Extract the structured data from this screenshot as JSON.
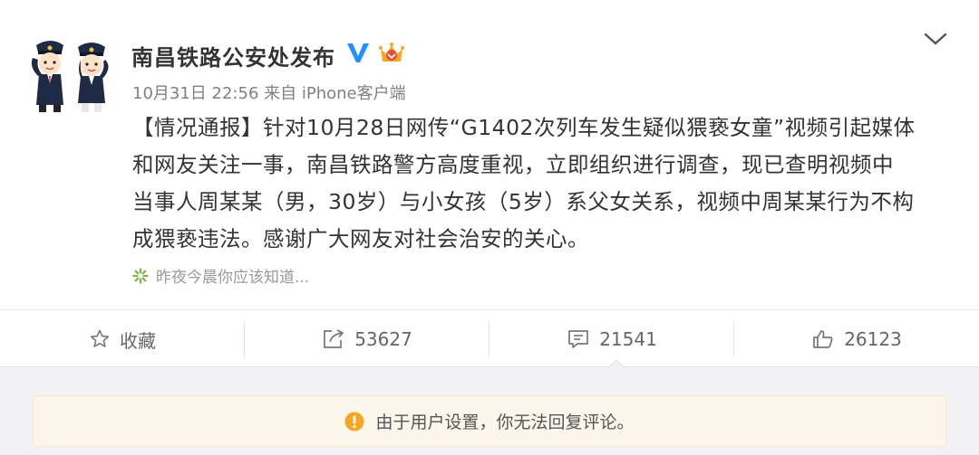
{
  "post": {
    "username": "南昌铁路公安处发布",
    "verified_badge": "V",
    "timestamp": "10月31日 22:56",
    "source_prefix": "来自",
    "client": "iPhone客户端",
    "content_lines": [
      "【情况通报】针对10月28日网传“G1402次列车发生疑似猥亵女童”视频引起媒体",
      "和网友关注一事，南昌铁路警方高度重视，立即组织进行调查，现已查明视频中",
      "当事人周某某（男，30岁）与小女孩（5岁）系父女关系，视频中周某某行为不构",
      "成猥亵违法。感谢广大网友对社会治安的关心。"
    ],
    "origin": "昨夜今晨你应该知道..."
  },
  "actions": {
    "favorite_label": "收藏",
    "repost_count": "53627",
    "comment_count": "21541",
    "like_count": "26123"
  },
  "notice": {
    "text": "由于用户设置，你无法回复评论。"
  },
  "colors": {
    "verified_blue": "#1e90ff",
    "warning_orange": "#f5a623",
    "spark_green": "#7ab648",
    "notice_bg": "#fdf6ec"
  },
  "icons": [
    "police-avatar",
    "verified-icon",
    "vip-crown-icon",
    "chevron-down-icon",
    "spark-icon",
    "star-icon",
    "repost-icon",
    "comment-icon",
    "thumbs-up-icon",
    "warning-icon"
  ]
}
